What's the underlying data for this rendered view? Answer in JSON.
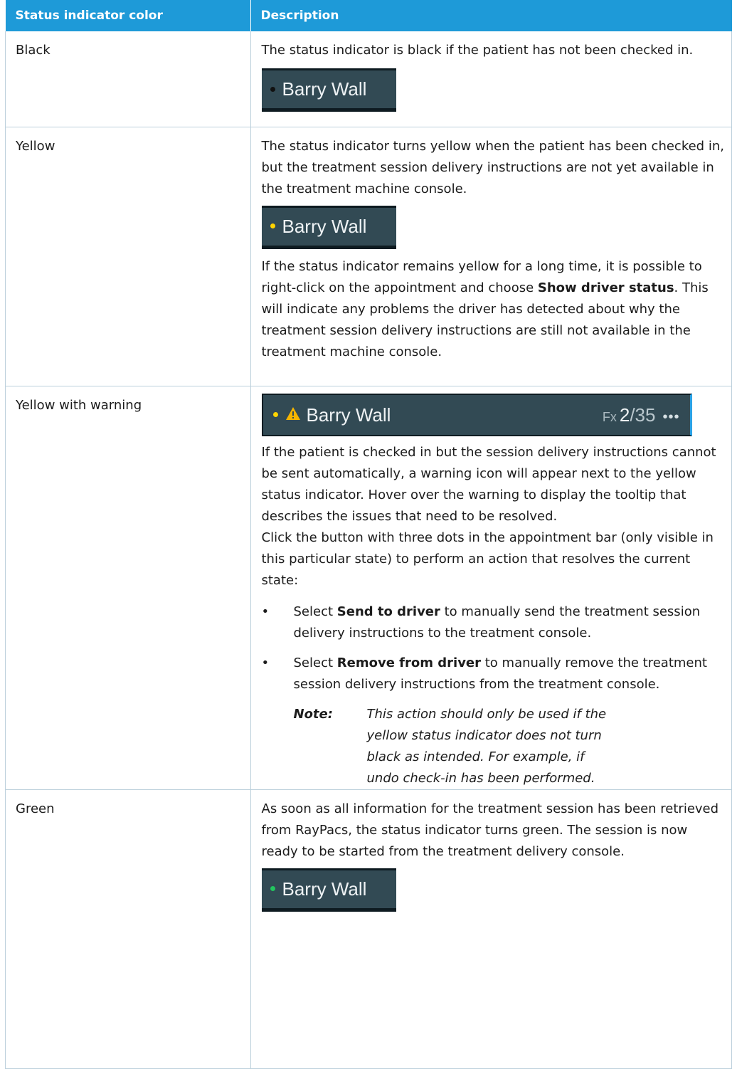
{
  "table": {
    "col1_header": "Status indicator color",
    "col2_header": "Description"
  },
  "rows": {
    "black": {
      "color": "Black",
      "desc": "The status indicator is black if the patient has not been checked in.",
      "patient": "Barry Wall",
      "dot_color": "#111111"
    },
    "yellow": {
      "color": "Yellow",
      "desc": "The status indicator turns yellow when the patient has been checked in, but the treatment session delivery instructions are not yet available in the treatment machine console.",
      "patient": "Barry Wall",
      "dot_color": "#ffd400",
      "more_pre": "If the status indicator remains yellow for a long time, it is possible to right-click on the appointment and choose ",
      "more_bold": "Show driver status",
      "more_post": ". This will indicate any problems the driver has detected about why the treatment session delivery instructions are still not available in the treatment machine console."
    },
    "warning": {
      "color": "Yellow with warning",
      "patient": "Barry Wall",
      "dot_color": "#ffd400",
      "fx_label": "Fx",
      "fx_current": "2",
      "fx_total": "/35",
      "more_icon": "•••",
      "para1": "If the patient is checked in but the session delivery instructions cannot be sent automatically, a warning icon will appear next to the yellow status indicator. Hover over the warning to display the tooltip that describes the issues that need to be resolved.",
      "para2": "Click the button with three dots in the appointment bar (only visible in this particular state) to perform an action that resolves the current state:",
      "bullets": [
        {
          "pre": "Select ",
          "bold": "Send to driver",
          "post": " to manually send the treatment session delivery instructions to the treatment console."
        },
        {
          "pre": "Select ",
          "bold": "Remove from driver",
          "post": " to manually remove the treatment session delivery instructions from the treatment console."
        }
      ],
      "note_label": "Note:",
      "note_text": "This action should only be used if the yellow status indicator does not turn black as intended. For example, if undo check-in has been performed."
    },
    "green": {
      "color": "Green",
      "desc": "As soon as all information for the treatment session has been retrieved from RayPacs, the status indicator turns green. The session is now ready to be started from the treatment delivery console.",
      "patient": "Barry Wall",
      "dot_color": "#22c55e"
    }
  },
  "icons": {
    "warning": "warning-triangle-icon",
    "bullet": "•"
  },
  "colors": {
    "header_bg": "#1e9ad8",
    "bar_bg": "#324a54",
    "warning_fill": "#f5b400"
  }
}
